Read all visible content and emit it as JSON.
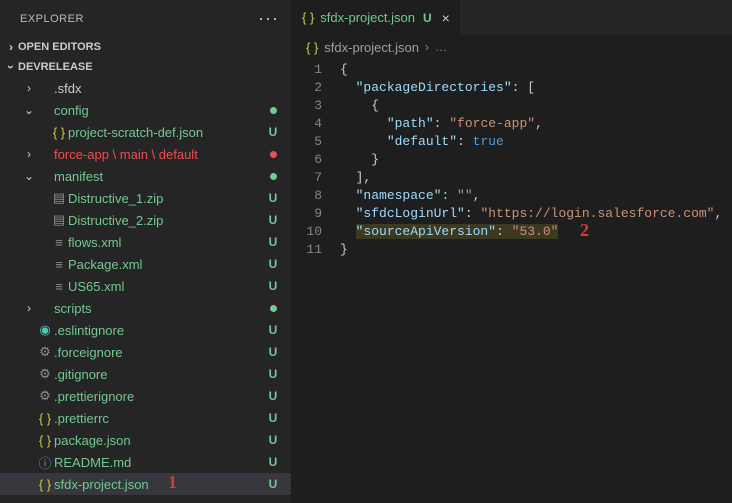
{
  "sidebar": {
    "explorer_label": "EXPLORER",
    "open_editors_label": "OPEN EDITORS",
    "project_label": "DEVRELEASE",
    "items": [
      {
        "name": ".sfdx",
        "type": "folder",
        "expanded": false,
        "color": "c-gray",
        "status": "",
        "indent": 1
      },
      {
        "name": "config",
        "type": "folder",
        "expanded": true,
        "color": "c-green",
        "status": "dot-green",
        "indent": 1
      },
      {
        "name": "project-scratch-def.json",
        "type": "json",
        "expanded": null,
        "color": "c-green",
        "status": "U",
        "indent": 2
      },
      {
        "name": "force-app \\ main \\ default",
        "type": "folder",
        "expanded": false,
        "color": "c-red",
        "status": "dot-red",
        "indent": 1
      },
      {
        "name": "manifest",
        "type": "folder",
        "expanded": true,
        "color": "c-green",
        "status": "dot-green",
        "indent": 1
      },
      {
        "name": "Distructive_1.zip",
        "type": "zip",
        "expanded": null,
        "color": "c-green",
        "status": "U",
        "indent": 2
      },
      {
        "name": "Distructive_2.zip",
        "type": "zip",
        "expanded": null,
        "color": "c-green",
        "status": "U",
        "indent": 2
      },
      {
        "name": "flows.xml",
        "type": "xml",
        "expanded": null,
        "color": "c-green",
        "status": "U",
        "indent": 2
      },
      {
        "name": "Package.xml",
        "type": "xml",
        "expanded": null,
        "color": "c-green",
        "status": "U",
        "indent": 2
      },
      {
        "name": "US65.xml",
        "type": "xml",
        "expanded": null,
        "color": "c-green",
        "status": "U",
        "indent": 2
      },
      {
        "name": "scripts",
        "type": "folder",
        "expanded": false,
        "color": "c-green",
        "status": "dot-green",
        "indent": 1
      },
      {
        "name": ".eslintignore",
        "type": "eslint",
        "expanded": null,
        "color": "c-green",
        "status": "U",
        "indent": 1
      },
      {
        "name": ".forceignore",
        "type": "gear",
        "expanded": null,
        "color": "c-green",
        "status": "U",
        "indent": 1
      },
      {
        "name": ".gitignore",
        "type": "gear",
        "expanded": null,
        "color": "c-green",
        "status": "U",
        "indent": 1
      },
      {
        "name": ".prettierignore",
        "type": "gear",
        "expanded": null,
        "color": "c-green",
        "status": "U",
        "indent": 1
      },
      {
        "name": ".prettierrc",
        "type": "json",
        "expanded": null,
        "color": "c-green",
        "status": "U",
        "indent": 1
      },
      {
        "name": "package.json",
        "type": "json",
        "expanded": null,
        "color": "c-green",
        "status": "U",
        "indent": 1
      },
      {
        "name": "README.md",
        "type": "info",
        "expanded": null,
        "color": "c-green",
        "status": "U",
        "indent": 1
      },
      {
        "name": "sfdx-project.json",
        "type": "json",
        "expanded": null,
        "color": "c-green",
        "status": "U",
        "indent": 1,
        "selected": true,
        "highlight": true
      }
    ]
  },
  "tab": {
    "filename": "sfdx-project.json",
    "status": "U"
  },
  "breadcrumb": {
    "file": "sfdx-project.json"
  },
  "code": {
    "lines": [
      "1",
      "2",
      "3",
      "4",
      "5",
      "6",
      "7",
      "8",
      "9",
      "10",
      "11"
    ],
    "packageDirectories_key": "\"packageDirectories\"",
    "path_key": "\"path\"",
    "path_val": "\"force-app\"",
    "default_key": "\"default\"",
    "default_val": "true",
    "namespace_key": "\"namespace\"",
    "namespace_val": "\"\"",
    "sfdcLoginUrl_key": "\"sfdcLoginUrl\"",
    "sfdcLoginUrl_val": "\"https://login.salesforce.com\"",
    "sourceApiVersion_key": "\"sourceApiVersion\"",
    "sourceApiVersion_val": "\"53.0\""
  },
  "annotations": {
    "one": "1",
    "two": "2"
  }
}
